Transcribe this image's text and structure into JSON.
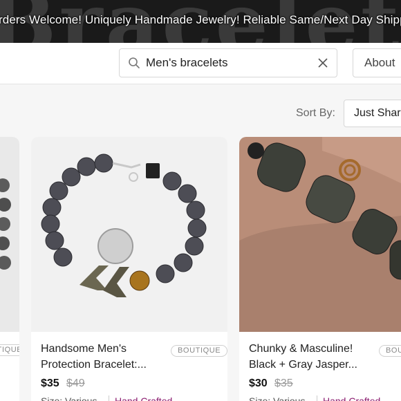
{
  "banner": {
    "background_word": "Bracelets",
    "text": "rders Welcome! Uniquely Handmade Jewelry! Reliable Same/Next Day Shipping!"
  },
  "search": {
    "value": "Men's bracelets",
    "icon": "search-icon",
    "clear_icon": "close-icon"
  },
  "nav": {
    "about_label": "About"
  },
  "sort": {
    "label": "Sort By:",
    "selected": "Just Shared"
  },
  "listings": [
    {
      "badge": "BOUTIQUE"
    },
    {
      "title_line1": "Handsome Men's",
      "title_line2": "Protection Bracelet:...",
      "badge": "BOUTIQUE",
      "price": "$35",
      "original_price": "$49",
      "size": "Size: Various",
      "tag": "Hand Crafted"
    },
    {
      "title_line1": "Chunky & Masculine!",
      "title_line2": "Black + Gray Jasper...",
      "badge": "BOUTIQUE",
      "price": "$30",
      "original_price": "$35",
      "size": "Size: Various",
      "tag": "Hand Crafted"
    }
  ],
  "colors": {
    "banner_bg": "#1a1a1a",
    "tag_color": "#8a1a6e",
    "page_bg": "#f6f6f6"
  }
}
